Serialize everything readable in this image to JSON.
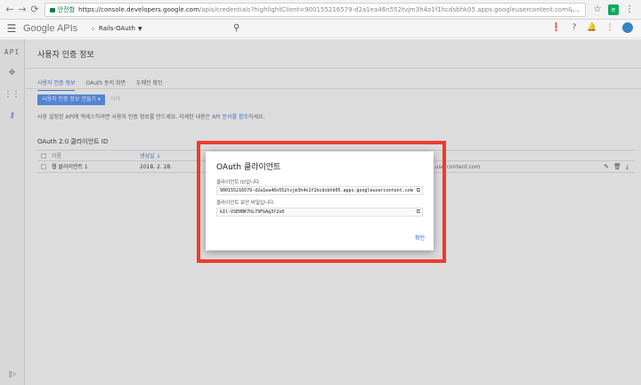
{
  "browser": {
    "secure_label": "안전함",
    "url_host": "https://console.developers.google.com",
    "url_path": "/apis/credentials?highlightClient=900155216579-d2a1ea46n552tvjm3h4o1f1hcdsbhk05.apps.googleusercontent.com&project=r..."
  },
  "header": {
    "logo_google": "Google",
    "logo_apis": "APIs",
    "project_name": "Rails-OAuth"
  },
  "rail": {
    "api_label": "API"
  },
  "page": {
    "title": "사용자 인증 정보",
    "tabs": [
      {
        "label": "사용자 인증 정보",
        "active": true
      },
      {
        "label": "OAuth 동의 화면",
        "active": false
      },
      {
        "label": "도메인 확인",
        "active": false
      }
    ],
    "create_button": "사용자 인증 정보 만들기",
    "delete_button": "삭제",
    "description_prefix": "사용 설정된 API에 액세스하려면 사용자 인증 정보를 만드세요. 자세한 내용은 ",
    "description_link": "API 문서를 참조",
    "description_suffix": "하세요."
  },
  "oauth_section": {
    "title": "OAuth 2.0 클라이언트 ID",
    "columns": {
      "name": "이름",
      "date": "생성일 ↓"
    },
    "rows": [
      {
        "name": "웹 클라이언트 1",
        "date": "2018. 2. 28.",
        "client_tail": "goo...usercontent.com"
      }
    ]
  },
  "dialog": {
    "title": "OAuth 클라이언트",
    "client_id_label": "클라이언트 ID입니다.",
    "client_id": "900155216579-d2a1ea46n552tvjm3h4o1f1hcdsbhk05.apps.googleusercontent.com",
    "secret_label": "클라이언트 보안 비밀입니다.",
    "secret": "kIl-VSEHBK7hL79FbAg3f2o0",
    "ok_button": "확인"
  },
  "colors": {
    "accent": "#4285f4",
    "link": "#3367d6",
    "highlight_border": "#f23a2f"
  }
}
